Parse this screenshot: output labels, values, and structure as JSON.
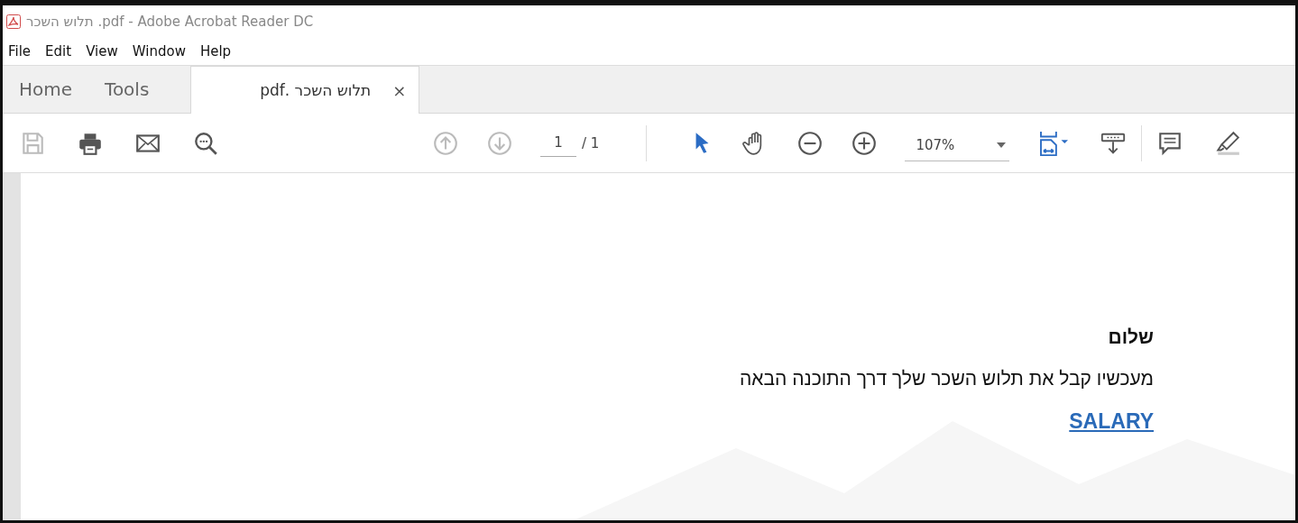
{
  "window": {
    "title": "תלוש השכר .pdf - Adobe Acrobat Reader DC"
  },
  "menu": [
    "File",
    "Edit",
    "View",
    "Window",
    "Help"
  ],
  "tabs": [
    {
      "label": "Home",
      "selected": false
    },
    {
      "label": "Tools",
      "selected": false
    },
    {
      "label": "תלוש השכר .pdf",
      "selected": true,
      "close": "×"
    }
  ],
  "toolbar": {
    "left": [
      {
        "kind": "save",
        "disabled": true
      },
      {
        "kind": "print",
        "disabled": false
      },
      {
        "kind": "mail",
        "disabled": false
      },
      {
        "kind": "find",
        "disabled": false
      }
    ],
    "page_up": {
      "disabled": true
    },
    "page_down": {
      "disabled": true
    },
    "page": {
      "value": "1",
      "total": "/ 1"
    },
    "tools": [
      {
        "kind": "select",
        "selected": true
      },
      {
        "kind": "hand",
        "selected": false
      }
    ],
    "zoom": {
      "value": "107%"
    },
    "right": [
      {
        "kind": "comment"
      },
      {
        "kind": "highlight"
      }
    ]
  },
  "document": {
    "greeting": "שלום",
    "message": "מעכשיו קבל את תלוש השכר שלך דרך התוכנה הבאה",
    "link": "SALARY"
  }
}
